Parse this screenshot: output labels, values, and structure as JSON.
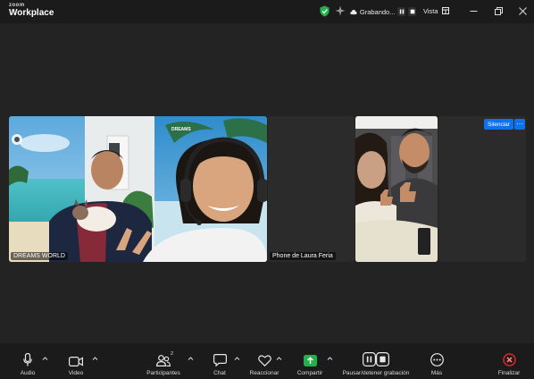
{
  "app": {
    "brand_small": "zoom",
    "brand_name": "Workplace"
  },
  "titlebar": {
    "recording_label": "Grabando...",
    "view_label": "Vista"
  },
  "participants": [
    {
      "name": "DREAMS WORLD"
    },
    {
      "name": "Phone de Laura Feria"
    },
    {
      "name": ""
    }
  ],
  "tile_actions": {
    "silence": "Silenciar",
    "more": "···"
  },
  "toolbar": {
    "audio": "Audio",
    "video": "Video",
    "participants": "Participantes",
    "participants_count": "2",
    "chat": "Chat",
    "react": "Reaccionar",
    "share": "Compartir",
    "recording": "Pausar/detener grabación",
    "more": "Más",
    "end": "Finalizar"
  },
  "colors": {
    "accent_blue": "#0e72ed",
    "share_green": "#23b14d",
    "end_red": "#e02828",
    "secure_green": "#23b14d"
  }
}
